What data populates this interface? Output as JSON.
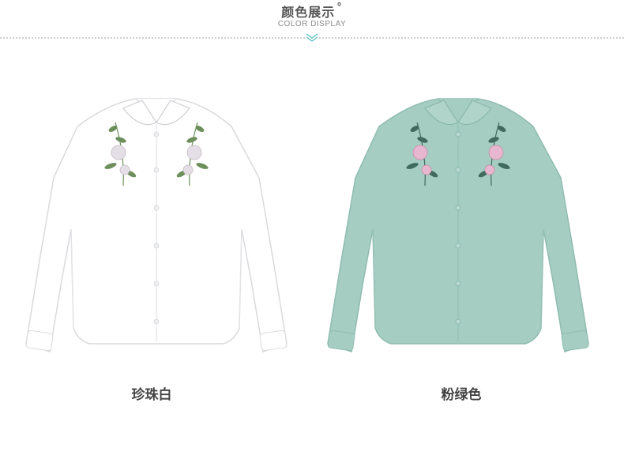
{
  "header": {
    "title": "颜色展示",
    "title_mark": "°",
    "subtitle": "COLOR DISPLAY"
  },
  "colors": [
    {
      "name": "珍珠白",
      "shirt_color": "#ffffff",
      "shade_color": "#e9eaec"
    },
    {
      "name": "粉绿色",
      "shirt_color": "#a6cdc2",
      "shade_color": "#8fbcb0"
    }
  ],
  "accent": "#6fc4c4"
}
